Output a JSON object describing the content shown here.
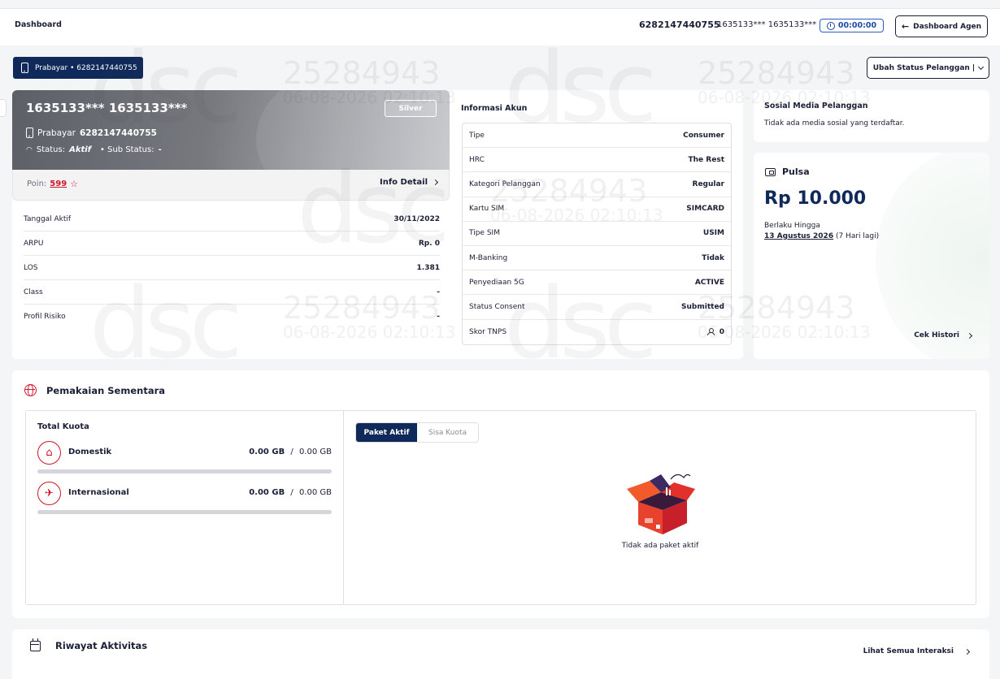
{
  "topbar": {
    "breadcrumb": "Dashboard",
    "msisdn": "6282147440755",
    "masked_name": "1635133*** 1635133***",
    "timer": "00:00:00",
    "dashboard_agen_label": "Dashboard Agen"
  },
  "subscriber_pill": "Prabayar • 6282147440755",
  "status_button_label": "Ubah Status Pelanggan |",
  "profile": {
    "name": "1635133*** 1635133***",
    "tier": "Silver",
    "type_label": "Prabayar",
    "msisdn": "6282147440755",
    "status_label": "Status:",
    "status_value": "Aktif",
    "sub_status_label": "• Sub Status:",
    "sub_status_value": "-",
    "poin_label": "Poin:",
    "poin_value": "599",
    "info_detail_label": "Info Detail",
    "fields": [
      {
        "label": "Tanggal Aktif",
        "value": "30/11/2022"
      },
      {
        "label": "ARPU",
        "value": "Rp. 0"
      },
      {
        "label": "LOS",
        "value": "1.381"
      },
      {
        "label": "Class",
        "value": "-"
      },
      {
        "label": "Profil Risiko",
        "value": "-"
      }
    ]
  },
  "info_akun": {
    "title": "Informasi Akun",
    "rows": [
      {
        "label": "Tipe",
        "value": "Consumer"
      },
      {
        "label": "HRC",
        "value": "The Rest"
      },
      {
        "label": "Kategori Pelanggan",
        "value": "Regular"
      },
      {
        "label": "Kartu SIM",
        "value": "SIMCARD"
      },
      {
        "label": "Tipe SIM",
        "value": "USIM"
      },
      {
        "label": "M-Banking",
        "value": "Tidak"
      },
      {
        "label": "Penyediaan 5G",
        "value": "ACTIVE"
      },
      {
        "label": "Status Consent",
        "value": "Submitted"
      },
      {
        "label": "Skor TNPS",
        "value": "0"
      }
    ]
  },
  "sosmed": {
    "title": "Sosial Media Pelanggan",
    "description": "Tidak ada media sosial yang terdaftar."
  },
  "pulsa": {
    "title": "Pulsa",
    "amount": "Rp 10.000",
    "valid_label": "Berlaku Hingga",
    "valid_date": "13 Agustus 2026",
    "valid_remaining": "(7 Hari lagi)",
    "history_label": "Cek Histori"
  },
  "usage": {
    "title": "Pemakaian Sementara",
    "total_label": "Total Kuota",
    "quotas": [
      {
        "label": "Domestik",
        "used": "0.00 GB",
        "sep": "/",
        "total": "0.00 GB",
        "fraction": 0
      },
      {
        "label": "Internasional",
        "used": "0.00 GB",
        "sep": "/",
        "total": "0.00 GB",
        "fraction": 0
      }
    ],
    "tabs": [
      {
        "label": "Paket Aktif",
        "active": true
      },
      {
        "label": "Sisa Kuota",
        "active": false
      }
    ],
    "empty_text": "Tidak ada paket aktif"
  },
  "riwayat": {
    "title": "Riwayat Aktivitas",
    "see_all_label": "Lihat Semua Interaksi"
  },
  "watermark": {
    "logo": "dsc",
    "id": "25284943",
    "datetime": "06-08-2026 02:10:13"
  },
  "colors": {
    "primary": "#0f2a5a",
    "accent_red": "#d1152a",
    "timer_blue": "#1d4ba8"
  }
}
